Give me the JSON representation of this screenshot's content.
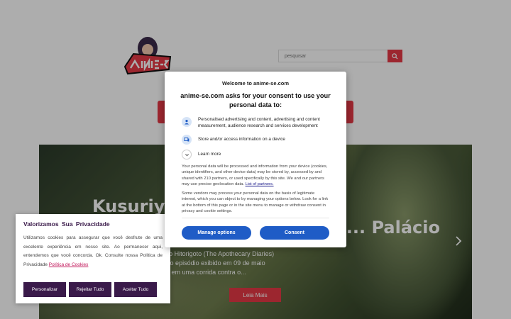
{
  "site": {
    "search_placeholder": "pesquisar"
  },
  "hero": {
    "title_line1": "Kusuriya ... Jinshi",
    "title_line2": "... Palácio",
    "excerpt_line1": "a temporada de Kusuriya no Hitorigoto (The Apothecary Diaries)",
    "excerpt_line2": "a vez mais emocionante, e o episódio exibido em 09 de maio",
    "excerpt_line3": "s leva a acompanhar Jinshi em uma corrida contra o...",
    "read_more": "Leia Mais"
  },
  "cookie_banner": {
    "title": "Valorizamos Sua Privacidade",
    "text": "Utilizamos cookies para assegurar que você desfrute de uma excelente experiência em nosso site. Ao permanecer aqui, entendemos que você concorda. Ok. Consulte nossa Política de Privacidade",
    "policy_link": "Política de Cookies",
    "buttons": [
      "Personalizar",
      "Rejeitar Tudo",
      "Aceitar Tudo"
    ]
  },
  "consent": {
    "site_label": "Welcome to anime-se.com",
    "heading": "anime-se.com asks for your consent to use your personal data to:",
    "purposes": [
      {
        "icon": "person-icon",
        "text": "Personalised advertising and content, advertising and content measurement, audience research and services development"
      },
      {
        "icon": "device-icon",
        "text": "Store and/or access information on a device"
      }
    ],
    "learn_more": "Learn more",
    "body1": "Your personal data will be processed and information from your device (cookies, unique identifiers, and other device data) may be stored by, accessed by and shared with 210 partners, or used specifically by this site. We and our partners may use precise geolocation data.",
    "partners_link": "List of partners.",
    "body2": "Some vendors may process your personal data on the basis of legitimate interest, which you can object to by managing your options below. Look for a link at the bottom of this page or in the site menu to manage or withdraw consent in privacy and cookie settings.",
    "manage_label": "Manage options",
    "consent_label": "Consent"
  },
  "colors": {
    "accent_red": "#e63946",
    "consent_blue": "#1f5cc6",
    "cookie_purple": "#3a1a4a"
  }
}
